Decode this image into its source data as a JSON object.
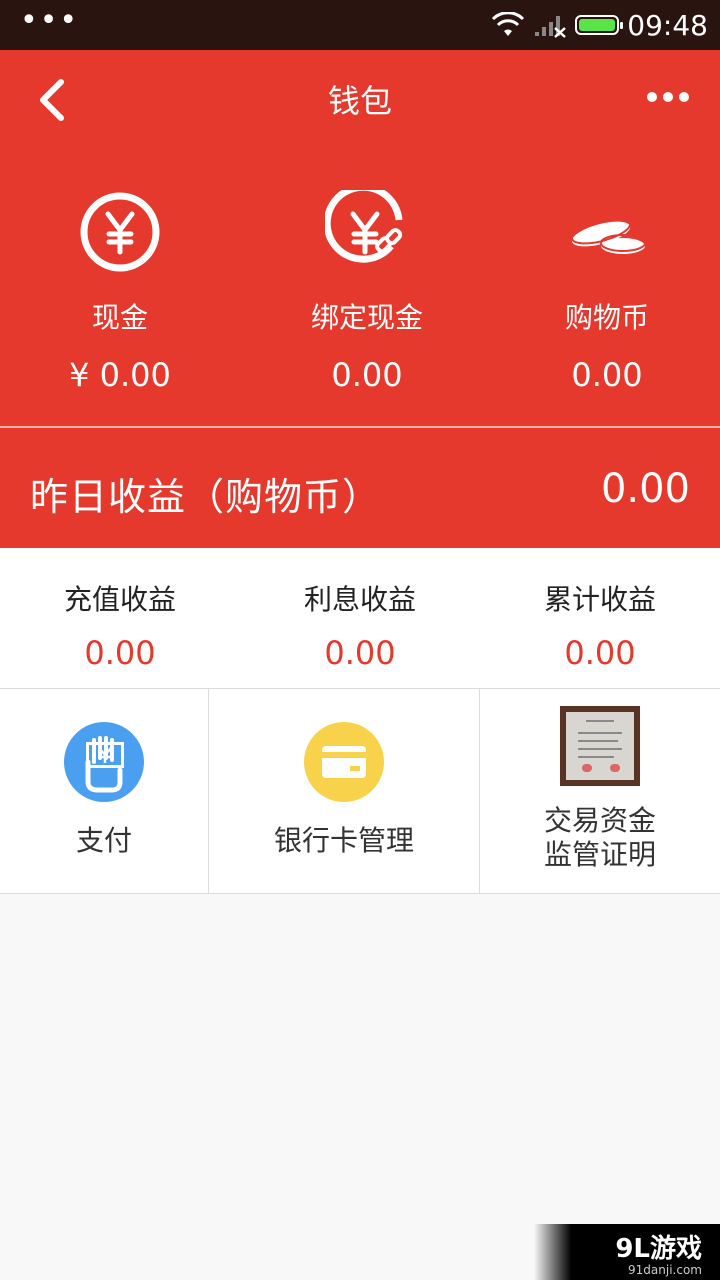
{
  "statusbar": {
    "time": "09:48",
    "dots": "•••",
    "icons": [
      "wifi-icon",
      "signal-icon",
      "battery-icon"
    ]
  },
  "header": {
    "title": "钱包",
    "back_icon": "chevron-left-icon",
    "more_icon": "more-dots-icon"
  },
  "balances": [
    {
      "label": "现金",
      "value": "¥ 0.00",
      "icon": "yuan-circle-icon"
    },
    {
      "label": "绑定现金",
      "value": "0.00",
      "icon": "yuan-link-icon"
    },
    {
      "label": "购物币",
      "value": "0.00",
      "icon": "coins-icon"
    }
  ],
  "yesterday": {
    "label": "昨日收益（购物币）",
    "value": "0.00"
  },
  "earnings": [
    {
      "label": "充值收益",
      "value": "0.00"
    },
    {
      "label": "利息收益",
      "value": "0.00"
    },
    {
      "label": "累计收益",
      "value": "0.00"
    }
  ],
  "actions": [
    {
      "label": "支付",
      "icon": "payment-hand-icon"
    },
    {
      "label": "银行卡管理",
      "icon": "bank-card-icon"
    },
    {
      "label_line1": "交易资金",
      "label_line2": "监管证明",
      "icon": "certificate-icon"
    }
  ],
  "watermark": {
    "logo": "9L游戏",
    "url": "91danji.com"
  },
  "colors": {
    "accent": "#e6392e",
    "statusbar": "#2a1410",
    "payment_icon": "#4a9ff0",
    "card_icon": "#f7d24a"
  }
}
